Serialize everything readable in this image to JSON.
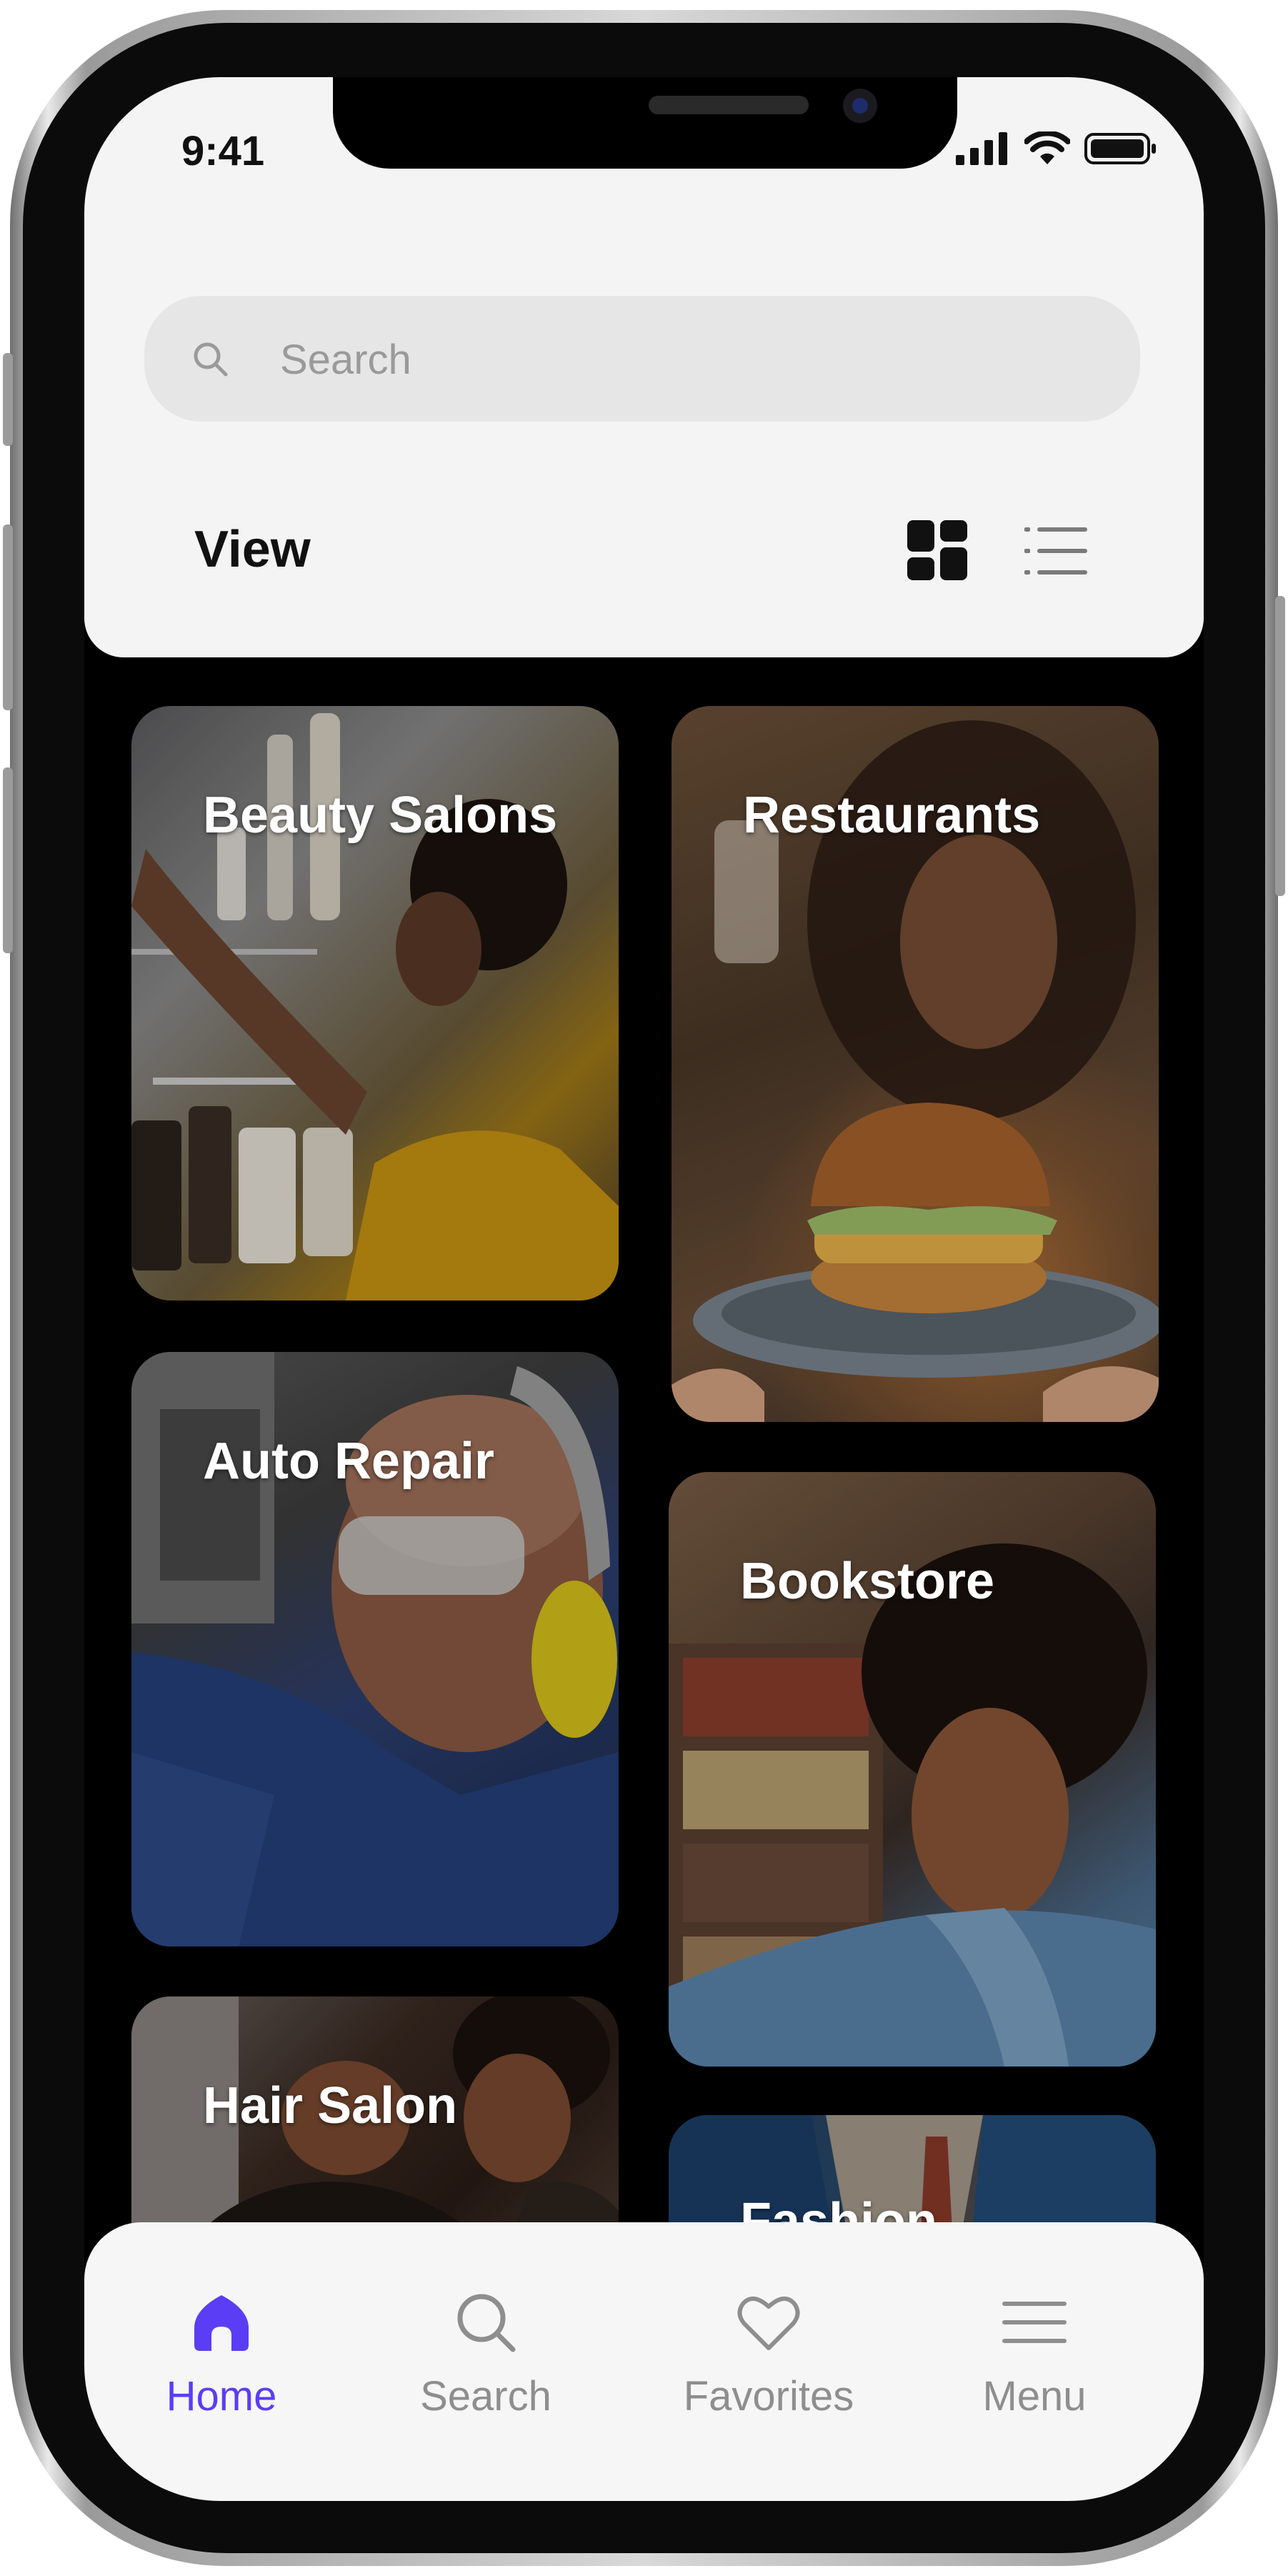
{
  "status_bar": {
    "time": "9:41"
  },
  "search": {
    "placeholder": "Search"
  },
  "view": {
    "label": "View",
    "active_mode": "grid"
  },
  "categories": [
    {
      "label": "Beauty Salons"
    },
    {
      "label": "Restaurants"
    },
    {
      "label": "Auto Repair"
    },
    {
      "label": "Bookstore"
    },
    {
      "label": "Hair Salon"
    },
    {
      "label": "Fashion"
    }
  ],
  "tabs": [
    {
      "label": "Home",
      "icon": "home-icon",
      "active": true
    },
    {
      "label": "Search",
      "icon": "search-icon",
      "active": false
    },
    {
      "label": "Favorites",
      "icon": "heart-icon",
      "active": false
    },
    {
      "label": "Menu",
      "icon": "menu-icon",
      "active": false
    }
  ],
  "colors": {
    "accent": "#5b3df5",
    "inactive": "#8e8e8e",
    "surface": "#f4f4f4"
  }
}
